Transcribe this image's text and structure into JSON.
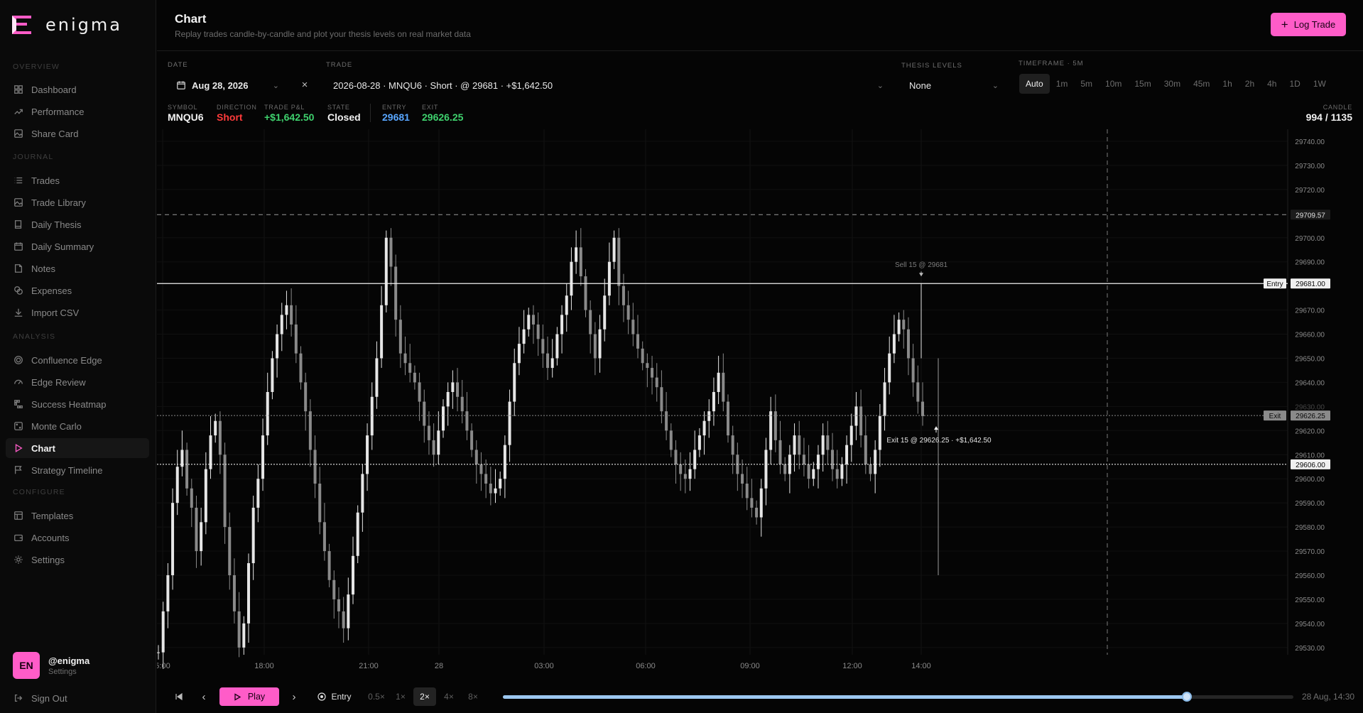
{
  "brand": {
    "name": "enigma",
    "accent": "#ff5cc8"
  },
  "sidebar": {
    "sections": [
      {
        "label": "OVERVIEW",
        "items": [
          {
            "label": "Dashboard",
            "icon": "grid-icon"
          },
          {
            "label": "Performance",
            "icon": "trend-icon"
          },
          {
            "label": "Share Card",
            "icon": "image-icon"
          }
        ]
      },
      {
        "label": "JOURNAL",
        "items": [
          {
            "label": "Trades",
            "icon": "list-icon"
          },
          {
            "label": "Trade Library",
            "icon": "image-icon"
          },
          {
            "label": "Daily Thesis",
            "icon": "book-icon"
          },
          {
            "label": "Daily Summary",
            "icon": "calendar-icon"
          },
          {
            "label": "Notes",
            "icon": "note-icon"
          },
          {
            "label": "Expenses",
            "icon": "coins-icon"
          },
          {
            "label": "Import CSV",
            "icon": "download-icon"
          }
        ]
      },
      {
        "label": "ANALYSIS",
        "items": [
          {
            "label": "Confluence Edge",
            "icon": "target-icon"
          },
          {
            "label": "Edge Review",
            "icon": "gauge-icon"
          },
          {
            "label": "Success Heatmap",
            "icon": "heatmap-icon"
          },
          {
            "label": "Monte Carlo",
            "icon": "dice-icon"
          },
          {
            "label": "Chart",
            "icon": "play-icon",
            "active": true
          },
          {
            "label": "Strategy Timeline",
            "icon": "flag-icon"
          }
        ]
      },
      {
        "label": "CONFIGURE",
        "items": [
          {
            "label": "Templates",
            "icon": "layout-icon"
          },
          {
            "label": "Accounts",
            "icon": "wallet-icon"
          },
          {
            "label": "Settings",
            "icon": "gear-icon"
          }
        ]
      }
    ],
    "user": {
      "initials": "EN",
      "name": "@enigma",
      "sub": "Settings"
    },
    "signout": "Sign Out"
  },
  "header": {
    "title": "Chart",
    "subtitle": "Replay trades candle-by-candle and plot your thesis levels on real market data",
    "log_trade": "Log Trade"
  },
  "controls": {
    "date_label": "DATE",
    "date_value": "Aug 28, 2026",
    "trade_label": "TRADE",
    "trade_value": "2026-08-28 · MNQU6 · Short · @ 29681 · +$1,642.50",
    "thesis_label": "THESIS LEVELS",
    "thesis_value": "None",
    "timeframe_label": "TIMEFRAME · 5M",
    "timeframes": [
      "Auto",
      "1m",
      "5m",
      "10m",
      "15m",
      "30m",
      "45m",
      "1h",
      "2h",
      "4h",
      "1D",
      "1W"
    ],
    "timeframe_active": "Auto"
  },
  "info": {
    "symbol_label": "SYMBOL",
    "symbol": "MNQU6",
    "direction_label": "DIRECTION",
    "direction": "Short",
    "pnl_label": "TRADE P&L",
    "pnl": "+$1,642.50",
    "state_label": "STATE",
    "state": "Closed",
    "entry_label": "ENTRY",
    "entry": "29681",
    "exit_label": "EXIT",
    "exit": "29626.25",
    "candle_label": "CANDLE",
    "candle": "994 / 1135"
  },
  "chart_data": {
    "type": "candlestick",
    "y_ticks": [
      "29740.00",
      "29730.00",
      "29720.00",
      "29700.00",
      "29690.00",
      "29670.00",
      "29660.00",
      "29650.00",
      "29640.00",
      "29630.00",
      "29620.00",
      "29610.00",
      "29600.00",
      "29590.00",
      "29580.00",
      "29570.00",
      "29560.00",
      "29550.00",
      "29540.00",
      "29530.00"
    ],
    "ylim": [
      29527,
      29745
    ],
    "x_ticks": [
      "5:00",
      "18:00",
      "21:00",
      "28",
      "03:00",
      "06:00",
      "09:00",
      "12:00",
      "14:00"
    ],
    "levels": [
      {
        "kind": "dashed-high",
        "price_label": "29709.57",
        "price": 29709.57
      },
      {
        "kind": "entry",
        "tag": "Entry",
        "price_label": "29681.00",
        "price": 29681
      },
      {
        "kind": "exit",
        "tag": "Exit",
        "price_label": "29626.25",
        "price": 29626.25
      },
      {
        "kind": "dotted",
        "price_label": "29606.00",
        "price": 29606
      }
    ],
    "annotations": {
      "sell": "Sell 15 @ 29681",
      "exit": "Exit 15 @ 29626.25 · +$1,642.50"
    },
    "series": [
      {
        "name": "",
        "values": [
          29528,
          29545,
          29560,
          29590,
          29605,
          29612,
          29596,
          29588,
          29570,
          29582,
          29604,
          29618,
          29624,
          29610,
          29580,
          29560,
          29545,
          29530,
          29540,
          29565,
          29588,
          29600,
          29618,
          29636,
          29650,
          29660,
          29668,
          29672,
          29664,
          29652,
          29640,
          29628,
          29612,
          29598,
          29582,
          29570,
          29558,
          29550,
          29545,
          29538,
          29552,
          29568,
          29586,
          29602,
          29618,
          29634,
          29650,
          29672,
          29700,
          29688,
          29666,
          29652,
          29648,
          29644,
          29640,
          29632,
          29622,
          29616,
          29610,
          29620,
          29630,
          29636,
          29640,
          29634,
          29628,
          29620,
          29612,
          29606,
          29602,
          29598,
          29594,
          29596,
          29600,
          29614,
          29632,
          29648,
          29656,
          29662,
          29668,
          29664,
          29658,
          29652,
          29646,
          29650,
          29660,
          29668,
          29676,
          29690,
          29696,
          29684,
          29670,
          29660,
          29650,
          29662,
          29676,
          29690,
          29700,
          29680,
          29672,
          29666,
          29660,
          29654,
          29648,
          29646,
          29642,
          29638,
          29628,
          29620,
          29612,
          29606,
          29602,
          29600,
          29604,
          29612,
          29618,
          29624,
          29628,
          29636,
          29644,
          29632,
          29618,
          29610,
          29602,
          29598,
          29592,
          29588,
          29584,
          29596,
          29612,
          29628,
          29616,
          29606,
          29602,
          29610,
          29618,
          29610,
          29606,
          29600,
          29604,
          29610,
          29618,
          29612,
          29604,
          29600,
          29606,
          29614,
          29622,
          29630,
          29618,
          29606,
          29602,
          29612,
          29626,
          29640,
          29652,
          29660,
          29666,
          29662,
          29650,
          29640,
          29632,
          29626
        ]
      }
    ]
  },
  "playback": {
    "play": "Play",
    "entry": "Entry",
    "speeds": [
      "0.5×",
      "1×",
      "2×",
      "4×",
      "8×"
    ],
    "speed_active": "2×",
    "progress": 0.865,
    "time": "28 Aug, 14:30"
  }
}
